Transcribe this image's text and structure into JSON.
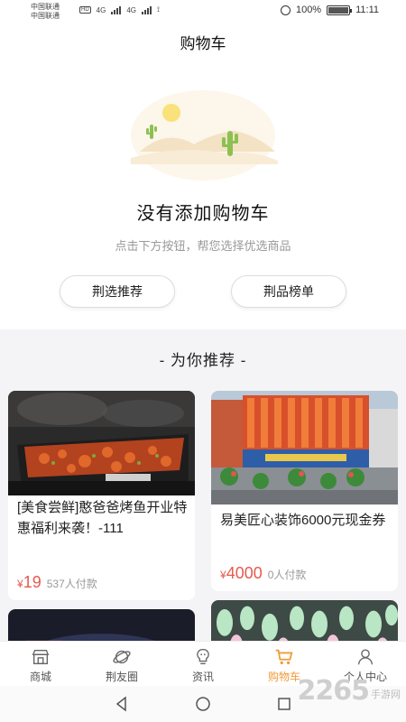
{
  "status_bar": {
    "carrier_1": "中国联通",
    "carrier_2": "中国联通",
    "net_1": "4G",
    "net_2": "4G",
    "battery": "100%",
    "time": "11:11"
  },
  "header": {
    "title": "购物车"
  },
  "empty_state": {
    "title": "没有添加购物车",
    "subtitle": "点击下方按钮，帮您选择优选商品",
    "illustration_icon": "desert-cactus-illustration"
  },
  "buttons": {
    "left_label": "荆选推荐",
    "right_label": "荆品榜单"
  },
  "recommend": {
    "title": "- 为你推荐 -",
    "items": [
      {
        "name": "[美食尝鲜]憨爸爸烤鱼开业特惠福利来袭！-111",
        "currency": "¥",
        "price": "19",
        "sold": "537人付款"
      },
      {
        "name": "易美匠心装饰6000元现金券",
        "currency": "¥",
        "price": "4000",
        "sold": "0人付款"
      }
    ]
  },
  "tabbar": {
    "items": [
      {
        "label": "商城",
        "icon": "store-icon"
      },
      {
        "label": "荆友圈",
        "icon": "planet-icon"
      },
      {
        "label": "资讯",
        "icon": "bulb-icon"
      },
      {
        "label": "购物车",
        "icon": "cart-icon"
      },
      {
        "label": "个人中心",
        "icon": "user-icon"
      }
    ],
    "active_index": 3
  },
  "watermark": {
    "number": "2265",
    "text": "手游网"
  },
  "colors": {
    "accent": "#f29b38",
    "price": "#e65a4f",
    "muted": "#999999"
  }
}
